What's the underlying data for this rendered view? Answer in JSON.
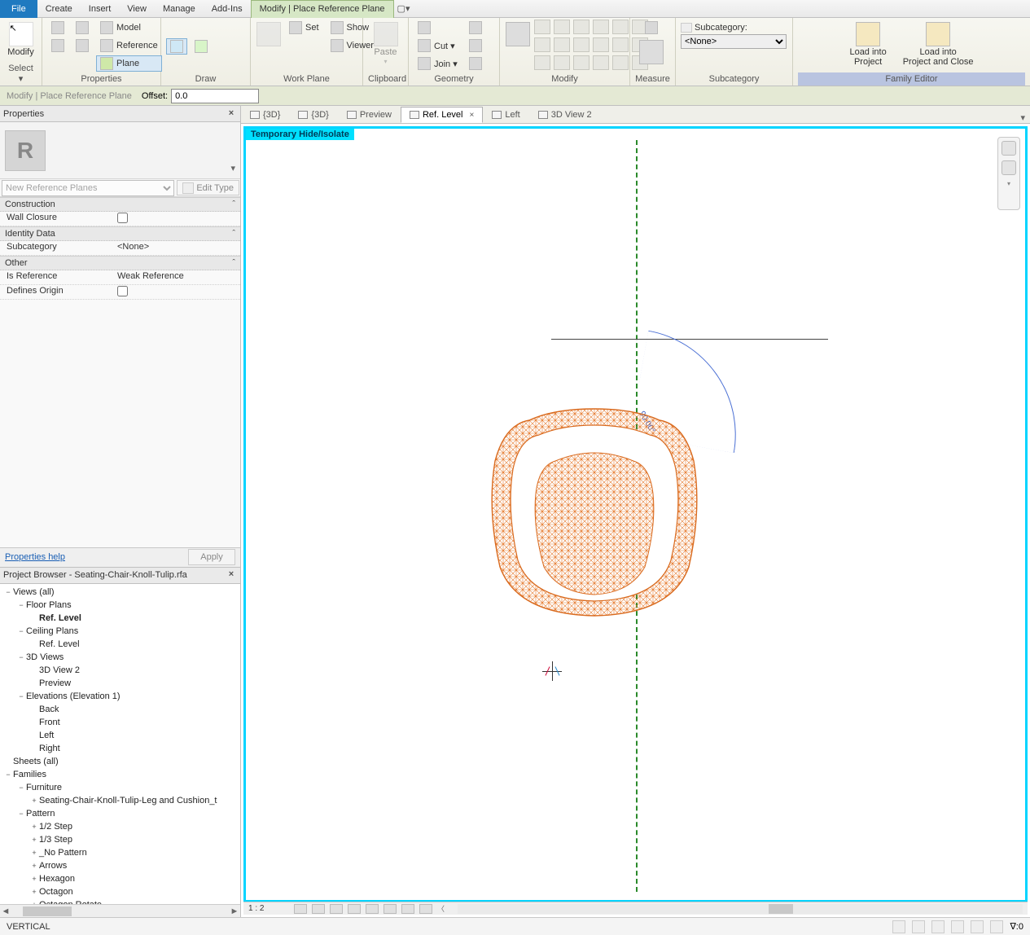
{
  "ribbonTabs": {
    "file": "File",
    "create": "Create",
    "insert": "Insert",
    "view": "View",
    "manage": "Manage",
    "addins": "Add-Ins",
    "contextual": "Modify | Place Reference Plane"
  },
  "ribbon": {
    "select": {
      "modify": "Modify",
      "selectLabel": "Select ▾",
      "group": "Properties"
    },
    "properties": {
      "model": "Model",
      "reference": "Reference",
      "plane": "Plane",
      "group": "Properties"
    },
    "draw": {
      "group": "Draw"
    },
    "workplane": {
      "set": "Set",
      "show": "Show",
      "viewer": "Viewer",
      "group": "Work Plane"
    },
    "clipboard": {
      "paste": "Paste",
      "cut": "Cut ▾",
      "join": "Join ▾",
      "group": "Clipboard"
    },
    "geometry": {
      "group": "Geometry"
    },
    "modify": {
      "group": "Modify"
    },
    "measure": {
      "group": "Measure"
    },
    "subcategory": {
      "label": "Subcategory:",
      "value": "<None>",
      "group": "Subcategory"
    },
    "familyEditor": {
      "loadInto": "Load into",
      "project": "Project",
      "projectClose": "Project and Close",
      "group": "Family Editor"
    }
  },
  "optionsBar": {
    "mode": "Modify | Place Reference Plane",
    "offsetLabel": "Offset:",
    "offsetValue": "0.0"
  },
  "propertiesPanel": {
    "title": "Properties",
    "typeSelector": "New Reference Planes",
    "editType": "Edit Type",
    "groups": {
      "construction": "Construction",
      "identity": "Identity Data",
      "other": "Other"
    },
    "rows": {
      "wallClosure": "Wall Closure",
      "subcategory": "Subcategory",
      "subcategoryVal": "<None>",
      "isReference": "Is Reference",
      "isReferenceVal": "Weak Reference",
      "definesOrigin": "Defines Origin"
    },
    "helpLink": "Properties help",
    "apply": "Apply"
  },
  "browser": {
    "title": "Project Browser - Seating-Chair-Knoll-Tulip.rfa",
    "tree": [
      {
        "d": 0,
        "exp": "−",
        "label": "Views (all)"
      },
      {
        "d": 1,
        "exp": "−",
        "label": "Floor Plans"
      },
      {
        "d": 2,
        "exp": "",
        "label": "Ref. Level",
        "bold": true
      },
      {
        "d": 1,
        "exp": "−",
        "label": "Ceiling Plans"
      },
      {
        "d": 2,
        "exp": "",
        "label": "Ref. Level"
      },
      {
        "d": 1,
        "exp": "−",
        "label": "3D Views"
      },
      {
        "d": 2,
        "exp": "",
        "label": "3D View 2"
      },
      {
        "d": 2,
        "exp": "",
        "label": "Preview"
      },
      {
        "d": 1,
        "exp": "−",
        "label": "Elevations (Elevation 1)"
      },
      {
        "d": 2,
        "exp": "",
        "label": "Back"
      },
      {
        "d": 2,
        "exp": "",
        "label": "Front"
      },
      {
        "d": 2,
        "exp": "",
        "label": "Left"
      },
      {
        "d": 2,
        "exp": "",
        "label": "Right"
      },
      {
        "d": 0,
        "exp": "",
        "label": "Sheets (all)"
      },
      {
        "d": 0,
        "exp": "−",
        "label": "Families"
      },
      {
        "d": 1,
        "exp": "−",
        "label": "Furniture"
      },
      {
        "d": 2,
        "exp": "+",
        "label": "Seating-Chair-Knoll-Tulip-Leg and Cushion_t"
      },
      {
        "d": 1,
        "exp": "−",
        "label": "Pattern"
      },
      {
        "d": 2,
        "exp": "+",
        "label": "1/2 Step"
      },
      {
        "d": 2,
        "exp": "+",
        "label": "1/3 Step"
      },
      {
        "d": 2,
        "exp": "+",
        "label": "_No Pattern"
      },
      {
        "d": 2,
        "exp": "+",
        "label": "Arrows"
      },
      {
        "d": 2,
        "exp": "+",
        "label": "Hexagon"
      },
      {
        "d": 2,
        "exp": "+",
        "label": "Octagon"
      },
      {
        "d": 2,
        "exp": "+",
        "label": "Octagon Rotate"
      }
    ]
  },
  "viewTabs": {
    "t1": "{3D}",
    "t2": "{3D}",
    "t3": "Preview",
    "t4": "Ref. Level",
    "t5": "Left",
    "t6": "3D View 2"
  },
  "canvas": {
    "badge": "Temporary Hide/Isolate",
    "angle": "90.00°",
    "scale": "1 : 2"
  },
  "status": {
    "left": "VERTICAL",
    "filter": "∇:0"
  }
}
